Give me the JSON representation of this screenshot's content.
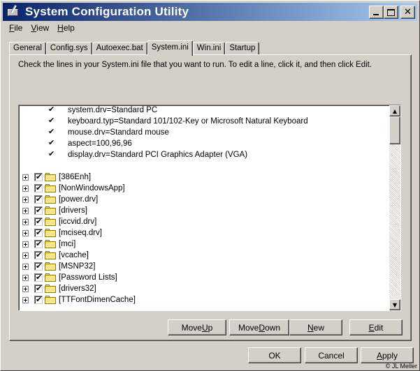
{
  "window": {
    "title": "System Configuration Utility"
  },
  "menu": [
    {
      "label_u": "F",
      "label_rest": "ile"
    },
    {
      "label_u": "V",
      "label_rest": "iew"
    },
    {
      "label_u": "H",
      "label_rest": "elp"
    }
  ],
  "tabs": [
    {
      "label": "General",
      "active": false
    },
    {
      "label": "Config.sys",
      "active": false
    },
    {
      "label": "Autoexec.bat",
      "active": false
    },
    {
      "label": "System.ini",
      "active": true
    },
    {
      "label": "Win.ini",
      "active": false
    },
    {
      "label": "Startup",
      "active": false
    }
  ],
  "instructions": "Check the lines in your System.ini file that you want to run. To edit a line, click it, and then click Edit.",
  "list": {
    "entries": [
      {
        "text": "system.drv=Standard PC",
        "checked": true
      },
      {
        "text": "keyboard.typ=Standard 101/102-Key or Microsoft Natural Keyboard",
        "checked": true
      },
      {
        "text": "mouse.drv=Standard mouse",
        "checked": true
      },
      {
        "text": "aspect=100,96,96",
        "checked": true
      },
      {
        "text": "display.drv=Standard PCI Graphics Adapter (VGA)",
        "checked": true
      }
    ],
    "sections": [
      {
        "text": "[386Enh]",
        "checked": true
      },
      {
        "text": "[NonWindowsApp]",
        "checked": true
      },
      {
        "text": "[power.drv]",
        "checked": true
      },
      {
        "text": "[drivers]",
        "checked": true
      },
      {
        "text": "[iccvid.drv]",
        "checked": true
      },
      {
        "text": "[mciseq.drv]",
        "checked": true
      },
      {
        "text": "[mci]",
        "checked": true
      },
      {
        "text": "[vcache]",
        "checked": true
      },
      {
        "text": "[MSNP32]",
        "checked": true
      },
      {
        "text": "[Password Lists]",
        "checked": true
      },
      {
        "text": "[drivers32]",
        "checked": true
      },
      {
        "text": "[TTFontDimenCache]",
        "checked": true
      }
    ]
  },
  "action_buttons": {
    "move_up": {
      "u": "U",
      "pre": "Move ",
      "post": "p"
    },
    "move_down": {
      "u": "D",
      "pre": "Move ",
      "post": "own"
    },
    "new": {
      "u": "N",
      "pre": "",
      "post": "ew"
    },
    "edit": {
      "u": "E",
      "pre": "",
      "post": "dit"
    }
  },
  "footer_buttons": {
    "ok": "OK",
    "cancel": "Cancel",
    "apply_u": "A",
    "apply_rest": "pply"
  },
  "copyright": "© JL Meller",
  "icons": {
    "checkmark": "✔",
    "scroll_up": "▲",
    "scroll_down": "▼",
    "close": "✕"
  }
}
